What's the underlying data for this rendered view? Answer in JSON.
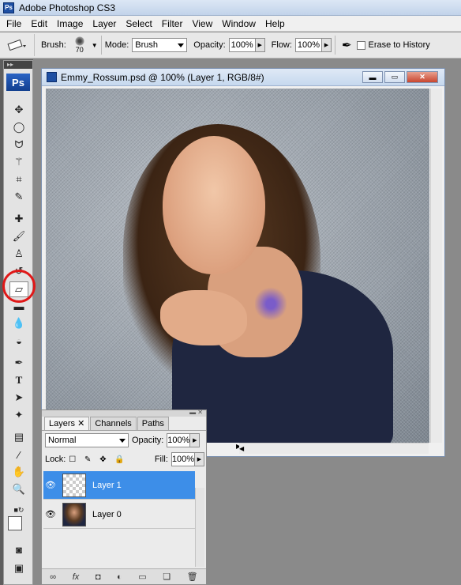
{
  "app": {
    "title": "Adobe Photoshop CS3",
    "logo": "Ps"
  },
  "menu": [
    "File",
    "Edit",
    "Image",
    "Layer",
    "Select",
    "Filter",
    "View",
    "Window",
    "Help"
  ],
  "options": {
    "brush_label": "Brush:",
    "brush_size": "70",
    "mode_label": "Mode:",
    "mode_value": "Brush",
    "opacity_label": "Opacity:",
    "opacity_value": "100%",
    "flow_label": "Flow:",
    "flow_value": "100%",
    "erase_history_label": "Erase to History"
  },
  "document": {
    "title": "Emmy_Rossum.psd @ 100% (Layer 1, RGB/8#)"
  },
  "toolbox": {
    "logo": "Ps",
    "tools": [
      "move",
      "marquee",
      "lasso",
      "magic-wand",
      "crop",
      "slice",
      "healing",
      "brush",
      "stamp",
      "history-brush",
      "eraser",
      "gradient",
      "blur",
      "dodge",
      "pen",
      "type",
      "path-select",
      "shape",
      "notes",
      "eyedropper",
      "hand",
      "zoom"
    ],
    "selected": "eraser"
  },
  "layers_panel": {
    "tabs": [
      "Layers",
      "Channels",
      "Paths"
    ],
    "active_tab": "Layers",
    "blend_mode": "Normal",
    "opacity_label": "Opacity:",
    "opacity_value": "100%",
    "lock_label": "Lock:",
    "fill_label": "Fill:",
    "fill_value": "100%",
    "layers": [
      {
        "name": "Layer 1",
        "selected": true
      },
      {
        "name": "Layer 0",
        "selected": false
      }
    ]
  },
  "colors": {
    "selection": "#3d8ee8",
    "highlight_circle": "#e01818"
  }
}
